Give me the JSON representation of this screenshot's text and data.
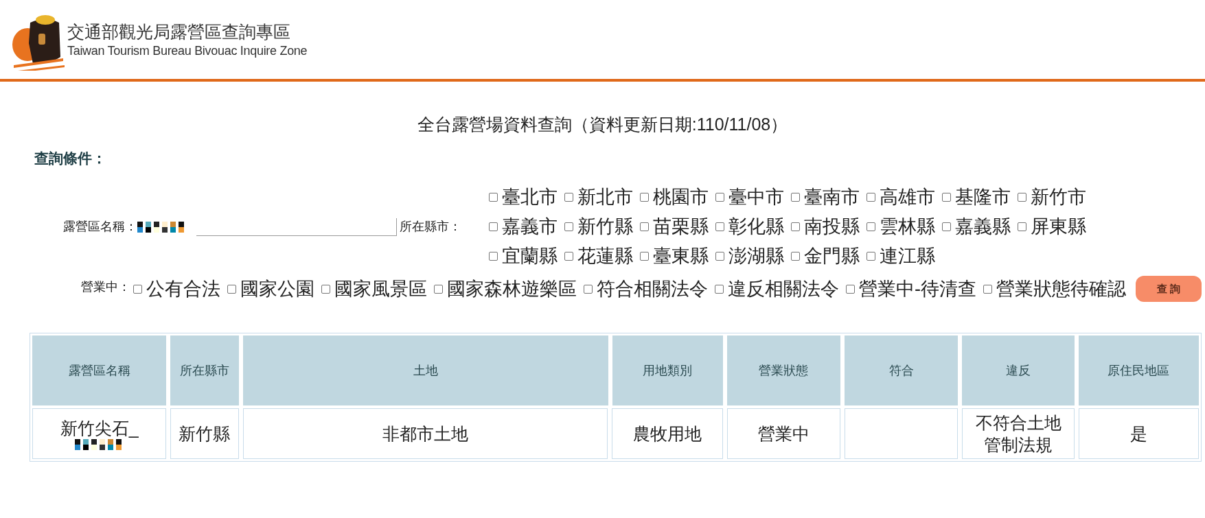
{
  "header": {
    "title": "交通部觀光局露營區查詢專區",
    "subtitle": "Taiwan Tourism Bureau Bivouac Inquire Zone"
  },
  "page_title": "全台露營場資料查詢（資料更新日期:110/11/08）",
  "conditions_label": "查詢條件：",
  "name_field": {
    "label": "露營區名稱："
  },
  "county_label": "所在縣市：",
  "counties": [
    {
      "label": "臺北市",
      "checked": false
    },
    {
      "label": "新北市",
      "checked": false
    },
    {
      "label": "桃園市",
      "checked": false
    },
    {
      "label": "臺中市",
      "checked": false
    },
    {
      "label": "臺南市",
      "checked": false
    },
    {
      "label": "高雄市",
      "checked": false
    },
    {
      "label": "基隆市",
      "checked": false
    },
    {
      "label": "新竹市",
      "checked": false
    },
    {
      "label": "嘉義市",
      "checked": false
    },
    {
      "label": "新竹縣",
      "checked": false
    },
    {
      "label": "苗栗縣",
      "checked": false
    },
    {
      "label": "彰化縣",
      "checked": false
    },
    {
      "label": "南投縣",
      "checked": false
    },
    {
      "label": "雲林縣",
      "checked": false
    },
    {
      "label": "嘉義縣",
      "checked": false
    },
    {
      "label": "屏東縣",
      "checked": false
    },
    {
      "label": "宜蘭縣",
      "checked": false
    },
    {
      "label": "花蓮縣",
      "checked": false
    },
    {
      "label": "臺東縣",
      "checked": false
    },
    {
      "label": "澎湖縣",
      "checked": false
    },
    {
      "label": "金門縣",
      "checked": false
    },
    {
      "label": "連江縣",
      "checked": false
    }
  ],
  "status_label": "營業中：",
  "statuses": [
    {
      "label": "公有合法",
      "checked": false
    },
    {
      "label": "國家公園",
      "checked": false
    },
    {
      "label": "國家風景區",
      "checked": false
    },
    {
      "label": "國家森林遊樂區",
      "checked": false
    },
    {
      "label": "符合相關法令",
      "checked": false
    },
    {
      "label": "違反相關法令",
      "checked": false
    },
    {
      "label": "營業中-待清查",
      "checked": false
    },
    {
      "label": "營業狀態待確認",
      "checked": false
    }
  ],
  "search_button": "查 詢",
  "table": {
    "columns": [
      "露營區名稱",
      "所在縣市",
      "土地",
      "用地類別",
      "營業狀態",
      "符合",
      "違反",
      "原住民地區"
    ],
    "rows": [
      {
        "name": "新竹尖石_",
        "county": "新竹縣",
        "land": "非都市土地",
        "land_use": "農牧用地",
        "status": "營業中",
        "violation": "不符合土地管制法規",
        "indigenous": "是"
      }
    ]
  }
}
